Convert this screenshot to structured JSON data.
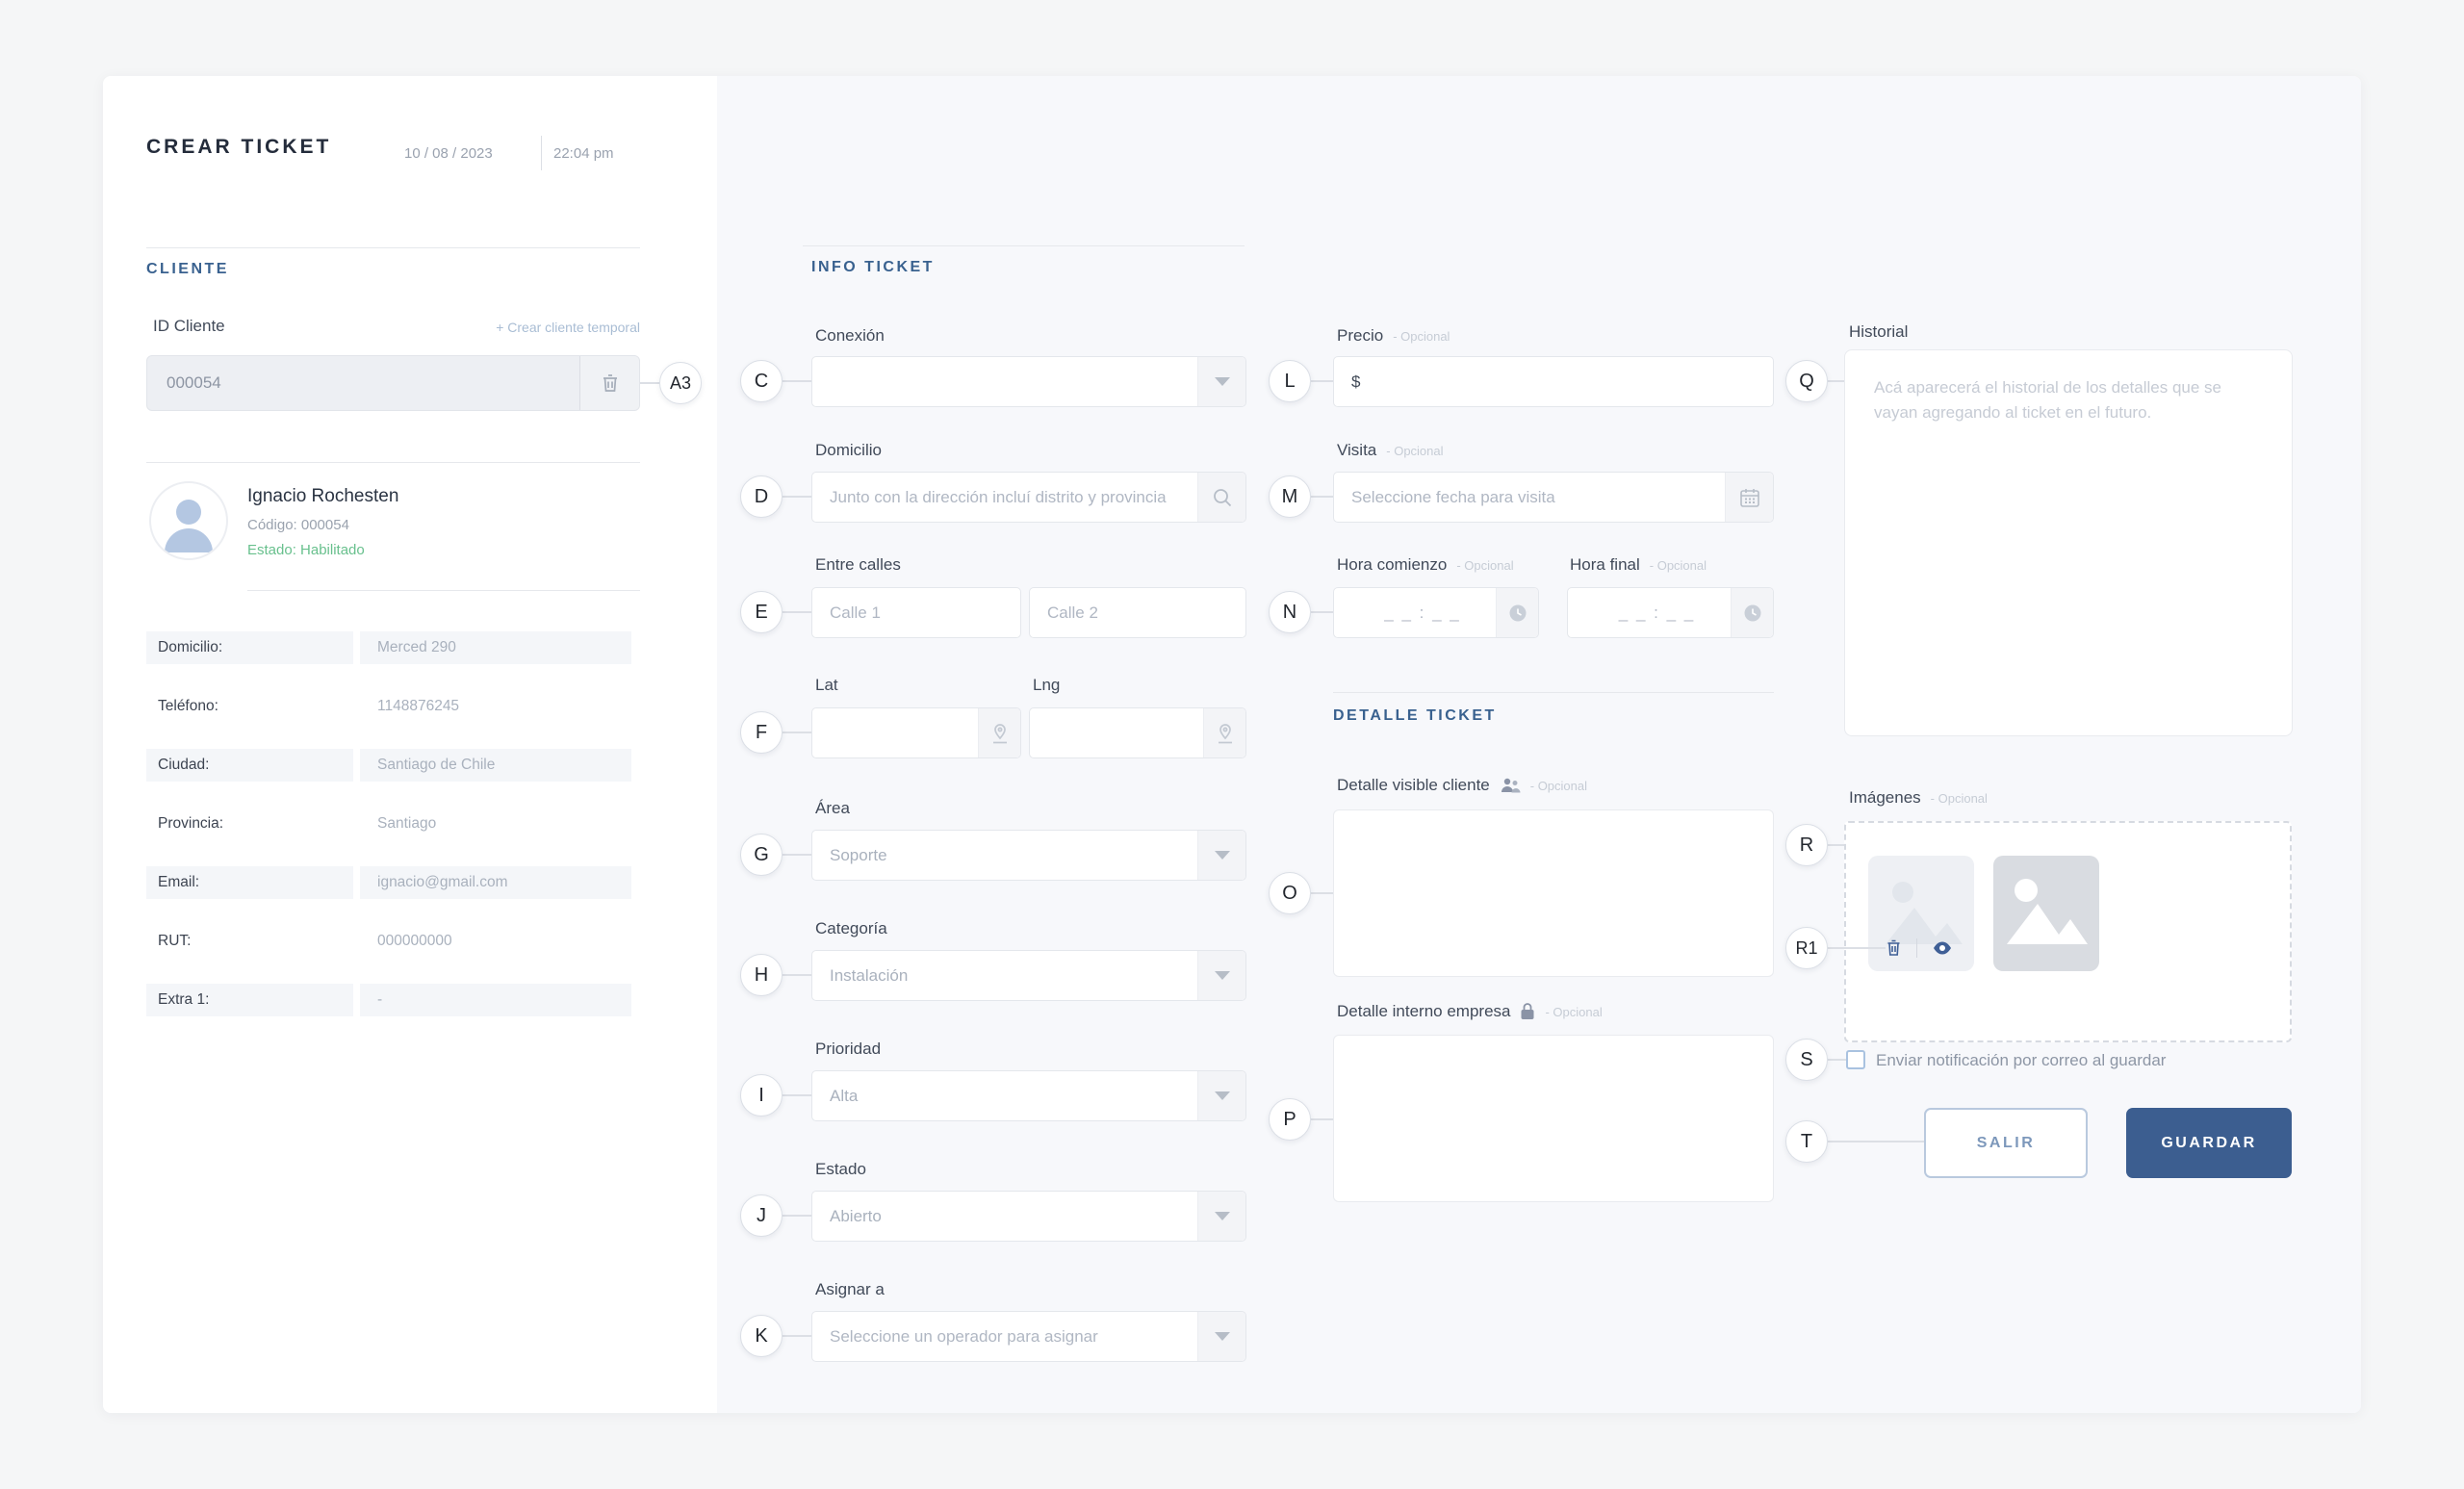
{
  "header": {
    "title": "CREAR TICKET",
    "date": "10 / 08 / 2023",
    "time": "22:04 pm"
  },
  "cliente": {
    "section_title": "CLIENTE",
    "id_label": "ID Cliente",
    "temp_link": "+ Crear cliente temporal",
    "id_value": "000054",
    "name": "Ignacio Rochesten",
    "codigo": "Código: 000054",
    "estado": "Estado: Habilitado",
    "details": [
      {
        "label": "Domicilio:",
        "value": "Merced 290"
      },
      {
        "label": "Teléfono:",
        "value": "1148876245"
      },
      {
        "label": "Ciudad:",
        "value": "Santiago de Chile"
      },
      {
        "label": "Provincia:",
        "value": "Santiago"
      },
      {
        "label": "Email:",
        "value": "ignacio@gmail.com"
      },
      {
        "label": "RUT:",
        "value": "000000000"
      },
      {
        "label": "Extra 1:",
        "value": "-"
      }
    ]
  },
  "info_ticket": {
    "section_title": "INFO TICKET",
    "conexion_label": "Conexión",
    "domicilio_label": "Domicilio",
    "domicilio_placeholder": "Junto con la dirección incluí distrito y provincia",
    "entre_calles_label": "Entre calles",
    "calle1_placeholder": "Calle 1",
    "calle2_placeholder": "Calle 2",
    "lat_label": "Lat",
    "lng_label": "Lng",
    "area_label": "Área",
    "area_value": "Soporte",
    "categoria_label": "Categoría",
    "categoria_value": "Instalación",
    "prioridad_label": "Prioridad",
    "prioridad_value": "Alta",
    "estado_label": "Estado",
    "estado_value": "Abierto",
    "asignar_label": "Asignar a",
    "asignar_placeholder": "Seleccione un operador para asignar"
  },
  "extras": {
    "opcional": "- Opcional",
    "precio_label": "Precio",
    "precio_prefix": "$",
    "visita_label": "Visita",
    "visita_placeholder": "Seleccione fecha para visita",
    "hora_comienzo_label": "Hora comienzo",
    "hora_final_label": "Hora final",
    "hora_placeholder": "_ _ : _ _"
  },
  "detalle_ticket": {
    "section_title": "DETALLE TICKET",
    "visible_label": "Detalle visible cliente",
    "interno_label": "Detalle interno empresa"
  },
  "historial": {
    "label": "Historial",
    "placeholder": "Acá aparecerá el historial de los detalles que se vayan agregando al ticket en el futuro."
  },
  "imagenes": {
    "label": "Imágenes"
  },
  "footer": {
    "notify_label": "Enviar notificación por correo al guardar",
    "salir": "SALIR",
    "guardar": "GUARDAR"
  },
  "annotations": {
    "markers": [
      "A3",
      "C",
      "D",
      "E",
      "F",
      "G",
      "H",
      "I",
      "J",
      "K",
      "L",
      "M",
      "N",
      "O",
      "P",
      "Q",
      "R",
      "R1",
      "S",
      "T"
    ]
  },
  "colors": {
    "accent_blue": "#39618f",
    "button_blue": "#3c5e90",
    "success_green": "#68c08d",
    "link_blue": "#a9bdd4"
  }
}
